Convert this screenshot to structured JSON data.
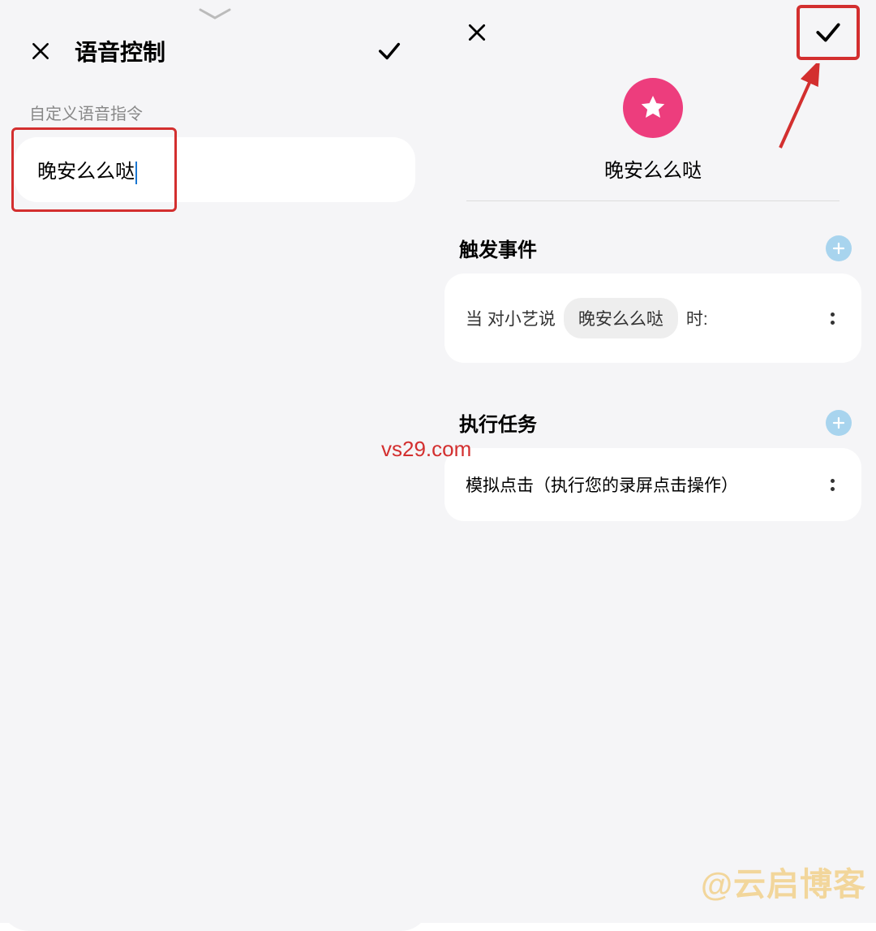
{
  "left": {
    "title": "语音控制",
    "section_label": "自定义语音指令",
    "input_value": "晚安么么哒"
  },
  "right": {
    "scene_title": "晚安么么哒",
    "trigger": {
      "heading": "触发事件",
      "prefix": "当 对小艺说",
      "chip": "晚安么么哒",
      "suffix": "时:"
    },
    "tasks": {
      "heading": "执行任务",
      "item": "模拟点击（执行您的录屏点击操作）"
    }
  },
  "watermarks": {
    "center": "vs29.com",
    "corner": "@云启博客"
  }
}
